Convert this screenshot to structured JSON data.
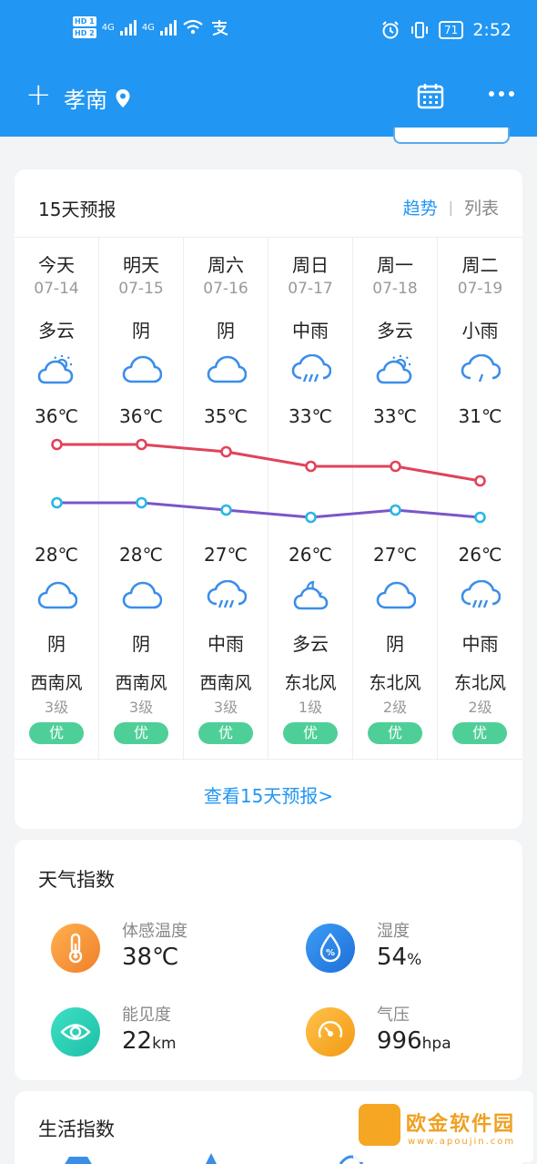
{
  "status": {
    "hd1": "HD 1",
    "hd2": "HD 2",
    "net1": "4G",
    "net2": "4G",
    "battery": "71",
    "time": "2:52"
  },
  "header": {
    "city": "孝南",
    "icons": [
      "plus-icon",
      "location-pin-icon",
      "calendar-icon",
      "more-icon"
    ]
  },
  "forecast": {
    "title": "15天预报",
    "tabs": {
      "trend": "趋势",
      "list": "列表"
    },
    "more_link": "查看15天预报>",
    "days": [
      {
        "day": "今天",
        "date": "07-14",
        "weather_day": "多云",
        "icon_day": "partly-cloudy-sun-icon",
        "high": "36℃",
        "low": "28℃",
        "icon_night": "cloudy-icon",
        "weather_night": "阴",
        "wind": "西南风",
        "level": "3级",
        "aqi": "优"
      },
      {
        "day": "明天",
        "date": "07-15",
        "weather_day": "阴",
        "icon_day": "cloudy-icon",
        "high": "36℃",
        "low": "28℃",
        "icon_night": "cloudy-icon",
        "weather_night": "阴",
        "wind": "西南风",
        "level": "3级",
        "aqi": "优"
      },
      {
        "day": "周六",
        "date": "07-16",
        "weather_day": "阴",
        "icon_day": "cloudy-icon",
        "high": "35℃",
        "low": "27℃",
        "icon_night": "rain-icon",
        "weather_night": "中雨",
        "wind": "西南风",
        "level": "3级",
        "aqi": "优"
      },
      {
        "day": "周日",
        "date": "07-17",
        "weather_day": "中雨",
        "icon_day": "rain-icon",
        "high": "33℃",
        "low": "26℃",
        "icon_night": "partly-cloudy-moon-icon",
        "weather_night": "多云",
        "wind": "东北风",
        "level": "1级",
        "aqi": "优"
      },
      {
        "day": "周一",
        "date": "07-18",
        "weather_day": "多云",
        "icon_day": "partly-cloudy-sun-icon",
        "high": "33℃",
        "low": "27℃",
        "icon_night": "cloudy-icon",
        "weather_night": "阴",
        "wind": "东北风",
        "level": "2级",
        "aqi": "优"
      },
      {
        "day": "周二",
        "date": "07-19",
        "weather_day": "小雨",
        "icon_day": "light-rain-icon",
        "high": "31℃",
        "low": "26℃",
        "icon_night": "rain-icon",
        "weather_night": "中雨",
        "wind": "东北风",
        "level": "2级",
        "aqi": "优"
      }
    ],
    "high_values": [
      36,
      36,
      35,
      33,
      33,
      31
    ],
    "low_values": [
      28,
      28,
      27,
      26,
      27,
      26
    ],
    "colors": {
      "high": "#e0435a",
      "low": "#7b55c8",
      "marker": "#29b6e8"
    }
  },
  "indices": {
    "title": "天气指数",
    "items": [
      {
        "label": "体感温度",
        "value": "38℃",
        "unit": "",
        "icon": "thermometer-icon",
        "color": "#f5953a"
      },
      {
        "label": "湿度",
        "value": "54",
        "unit": "%",
        "icon": "humidity-icon",
        "color": "#2a84e8"
      },
      {
        "label": "能见度",
        "value": "22",
        "unit": "km",
        "icon": "eye-icon",
        "color": "#27d0b4"
      },
      {
        "label": "气压",
        "value": "996",
        "unit": "hpa",
        "icon": "gauge-icon",
        "color": "#f5a623"
      }
    ]
  },
  "life": {
    "title": "生活指数"
  },
  "watermark": {
    "text": "欧金软件园",
    "url": "www.apoujin.com"
  }
}
